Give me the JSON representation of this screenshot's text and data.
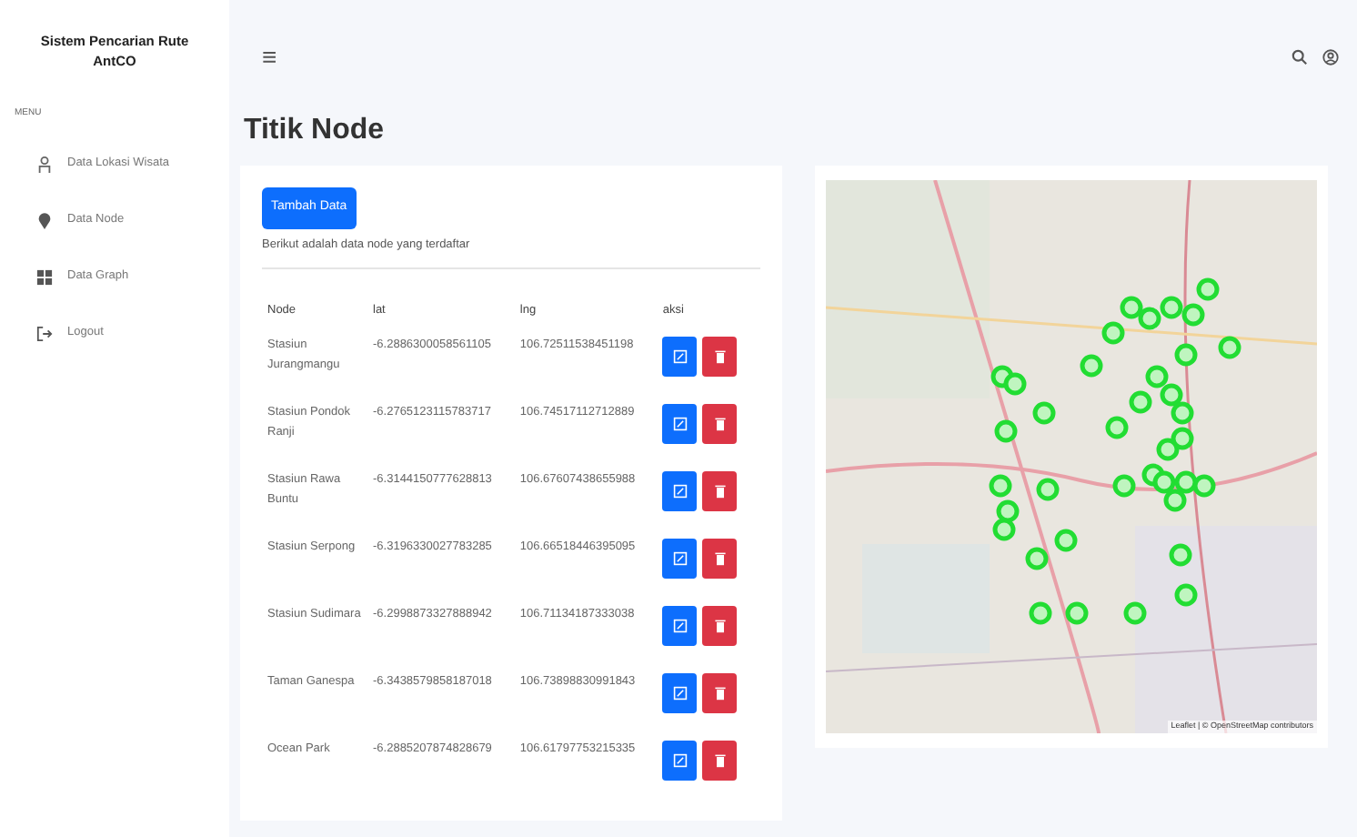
{
  "sidebar": {
    "title": "Sistem Pencarian Rute AntCO",
    "section": "MENU",
    "items": [
      {
        "label": "Data Lokasi Wisata"
      },
      {
        "label": "Data Node"
      },
      {
        "label": "Data Graph"
      },
      {
        "label": "Logout"
      }
    ]
  },
  "topbar": {
    "menu": "≡"
  },
  "page": {
    "title": "Titik Node"
  },
  "card": {
    "button": "Tambah Data",
    "caption": "Berikut adalah data node yang terdaftar",
    "table": {
      "columns": [
        "Node",
        "lat",
        "lng",
        "aksi"
      ],
      "rows": [
        {
          "node": "Stasiun Jurangmangu",
          "lat": "-6.2886300058561105",
          "lng": "106.72511538451198"
        },
        {
          "node": "Stasiun Pondok Ranji",
          "lat": "-6.2765123115783717",
          "lng": "106.74517112712889"
        },
        {
          "node": "Stasiun Rawa Buntu",
          "lat": "-6.3144150777628813",
          "lng": "106.67607438655988"
        },
        {
          "node": "Stasiun Serpong",
          "lat": "-6.3196330027783285",
          "lng": "106.66518446395095"
        },
        {
          "node": "Stasiun Sudimara",
          "lat": "-6.2998873327888942",
          "lng": "106.71134187333038"
        },
        {
          "node": "Taman Ganespa",
          "lat": "-6.3438579858187018",
          "lng": "106.73898830991843"
        },
        {
          "node": "Ocean Park",
          "lat": "-6.2885207874828679",
          "lng": "106.61797753215335"
        }
      ]
    }
  },
  "map": {
    "attribution": "Leaflet | © OpenStreetMap contributors"
  }
}
